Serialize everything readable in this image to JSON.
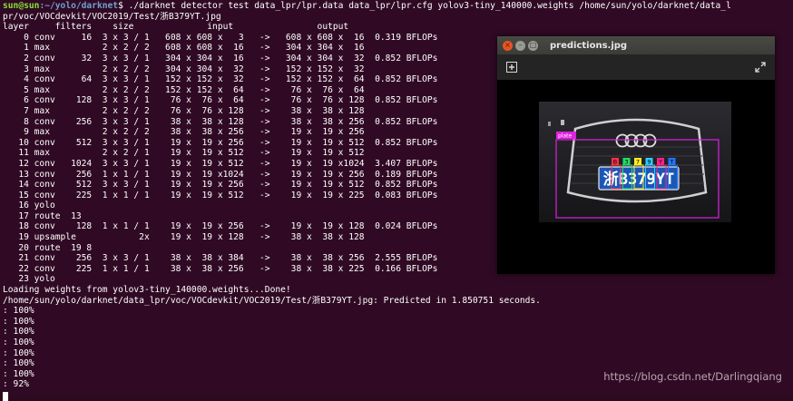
{
  "terminal": {
    "prompt_user": "sun@sun",
    "prompt_path": ":~/yolo/darknet",
    "command": "$ ./darknet detector test data_lpr/lpr.data data_lpr/lpr.cfg yolov3-tiny_140000.weights /home/sun/yolo/darknet/data_l",
    "lines": [
      "pr/voc/VOCdevkit/VOC2019/Test/浙B379YT.jpg",
      "layer     filters    size              input                output",
      "    0 conv     16  3 x 3 / 1   608 x 608 x   3   ->   608 x 608 x  16  0.319 BFLOPs",
      "    1 max          2 x 2 / 2   608 x 608 x  16   ->   304 x 304 x  16",
      "    2 conv     32  3 x 3 / 1   304 x 304 x  16   ->   304 x 304 x  32  0.852 BFLOPs",
      "    3 max          2 x 2 / 2   304 x 304 x  32   ->   152 x 152 x  32",
      "    4 conv     64  3 x 3 / 1   152 x 152 x  32   ->   152 x 152 x  64  0.852 BFLOPs",
      "    5 max          2 x 2 / 2   152 x 152 x  64   ->    76 x  76 x  64",
      "    6 conv    128  3 x 3 / 1    76 x  76 x  64   ->    76 x  76 x 128  0.852 BFLOPs",
      "    7 max          2 x 2 / 2    76 x  76 x 128   ->    38 x  38 x 128",
      "    8 conv    256  3 x 3 / 1    38 x  38 x 128   ->    38 x  38 x 256  0.852 BFLOPs",
      "    9 max          2 x 2 / 2    38 x  38 x 256   ->    19 x  19 x 256",
      "   10 conv    512  3 x 3 / 1    19 x  19 x 256   ->    19 x  19 x 512  0.852 BFLOPs",
      "   11 max          2 x 2 / 1    19 x  19 x 512   ->    19 x  19 x 512",
      "   12 conv   1024  3 x 3 / 1    19 x  19 x 512   ->    19 x  19 x1024  3.407 BFLOPs",
      "   13 conv    256  1 x 1 / 1    19 x  19 x1024   ->    19 x  19 x 256  0.189 BFLOPs",
      "   14 conv    512  3 x 3 / 1    19 x  19 x 256   ->    19 x  19 x 512  0.852 BFLOPs",
      "   15 conv    225  1 x 1 / 1    19 x  19 x 512   ->    19 x  19 x 225  0.083 BFLOPs",
      "   16 yolo",
      "   17 route  13",
      "   18 conv    128  1 x 1 / 1    19 x  19 x 256   ->    19 x  19 x 128  0.024 BFLOPs",
      "   19 upsample            2x    19 x  19 x 128   ->    38 x  38 x 128",
      "   20 route  19 8",
      "   21 conv    256  3 x 3 / 1    38 x  38 x 384   ->    38 x  38 x 256  2.555 BFLOPs",
      "   22 conv    225  1 x 1 / 1    38 x  38 x 256   ->    38 x  38 x 225  0.166 BFLOPs",
      "   23 yolo",
      "Loading weights from yolov3-tiny_140000.weights...Done!",
      "/home/sun/yolo/darknet/data_lpr/voc/VOCdevkit/VOC2019/Test/浙B379YT.jpg: Predicted in 1.850751 seconds.",
      ": 100%",
      ": 100%",
      ": 100%",
      ": 100%",
      ": 100%",
      ": 100%",
      ": 100%",
      ": 92%"
    ]
  },
  "window": {
    "title": "predictions.jpg",
    "zoom_icon": "zoom-in-icon",
    "expand_icon": "expand-icon",
    "detection_label": "plate",
    "plate_text": "浙B379YT",
    "char_labels": [
      "B",
      "3",
      "7",
      "9",
      "Y",
      "T"
    ],
    "char_colors": [
      "#ff3344",
      "#22dd66",
      "#ffee22",
      "#33ccff",
      "#ff2288",
      "#2277ff"
    ],
    "box_color": "#e020e0"
  },
  "watermark": "https://blog.csdn.net/Darlingqiang"
}
